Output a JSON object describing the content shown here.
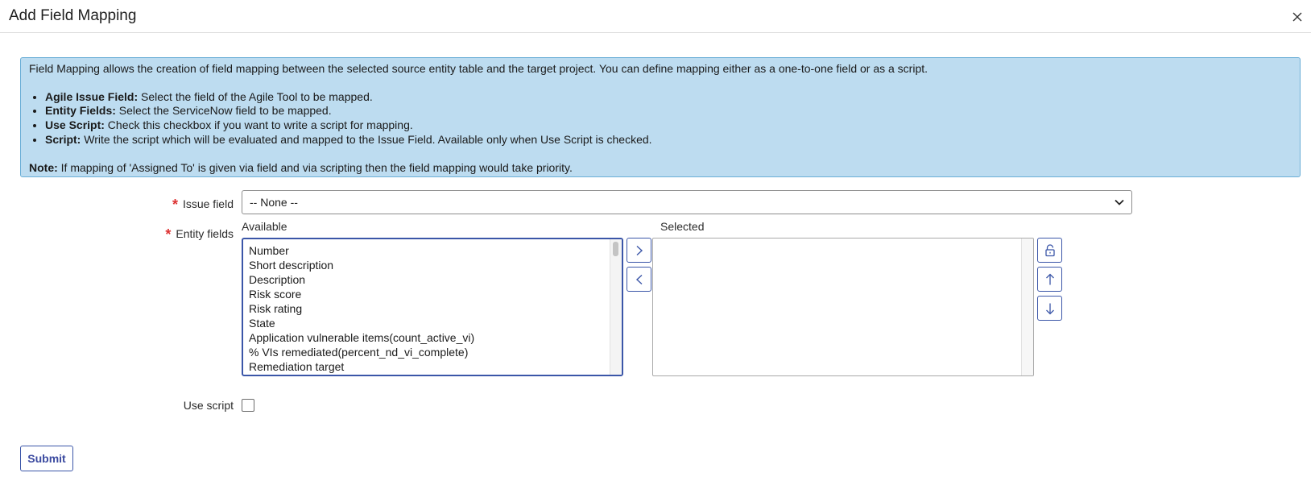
{
  "dialog": {
    "title": "Add Field Mapping"
  },
  "info": {
    "intro": "Field Mapping allows the creation of field mapping between the selected source entity table and the target project. You can define mapping either as a one-to-one field or as a script.",
    "items": [
      {
        "term": "Agile Issue Field:",
        "desc": " Select the field of the Agile Tool to be mapped."
      },
      {
        "term": "Entity Fields:",
        "desc": " Select the ServiceNow field to be mapped."
      },
      {
        "term": "Use Script:",
        "desc": " Check this checkbox if you want to write a script for mapping."
      },
      {
        "term": "Script:",
        "desc": " Write the script which will be evaluated and mapped to the Issue Field. Available only when Use Script is checked."
      }
    ],
    "note_term": "Note:",
    "note_desc": " If mapping of 'Assigned To' is given via field and via scripting then the field mapping would take priority."
  },
  "form": {
    "issue_field_label": "Issue field",
    "issue_field_value": "-- None --",
    "entity_fields_label": "Entity fields",
    "available_label": "Available",
    "selected_label": "Selected",
    "available_items": [
      "Number",
      "Short description",
      "Description",
      "Risk score",
      "Risk rating",
      "State",
      "Application vulnerable items(count_active_vi)",
      "% VIs remediated(percent_nd_vi_complete)",
      "Remediation target"
    ],
    "selected_items": [],
    "use_script_label": "Use script",
    "use_script_checked": false,
    "submit_label": "Submit"
  },
  "icons": {
    "close": "close-icon",
    "add": "chevron-right-icon",
    "remove": "chevron-left-icon",
    "lock": "lock-icon",
    "move_up": "arrow-up-icon",
    "move_down": "arrow-down-icon",
    "dropdown": "chevron-down-icon"
  },
  "colors": {
    "info_bg": "#bddcf0",
    "info_border": "#6aaed6",
    "accent": "#3b56a8",
    "required": "#dd3333"
  }
}
